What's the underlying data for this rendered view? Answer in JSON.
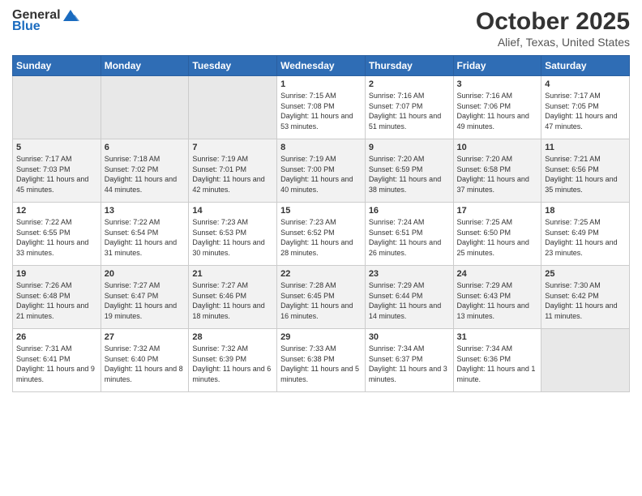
{
  "header": {
    "logo_general": "General",
    "logo_blue": "Blue",
    "month_title": "October 2025",
    "location": "Alief, Texas, United States"
  },
  "weekdays": [
    "Sunday",
    "Monday",
    "Tuesday",
    "Wednesday",
    "Thursday",
    "Friday",
    "Saturday"
  ],
  "rows": [
    [
      {
        "day": "",
        "empty": true
      },
      {
        "day": "",
        "empty": true
      },
      {
        "day": "",
        "empty": true
      },
      {
        "day": "1",
        "sunrise": "7:15 AM",
        "sunset": "7:08 PM",
        "daylight": "11 hours and 53 minutes."
      },
      {
        "day": "2",
        "sunrise": "7:16 AM",
        "sunset": "7:07 PM",
        "daylight": "11 hours and 51 minutes."
      },
      {
        "day": "3",
        "sunrise": "7:16 AM",
        "sunset": "7:06 PM",
        "daylight": "11 hours and 49 minutes."
      },
      {
        "day": "4",
        "sunrise": "7:17 AM",
        "sunset": "7:05 PM",
        "daylight": "11 hours and 47 minutes."
      }
    ],
    [
      {
        "day": "5",
        "sunrise": "7:17 AM",
        "sunset": "7:03 PM",
        "daylight": "11 hours and 45 minutes."
      },
      {
        "day": "6",
        "sunrise": "7:18 AM",
        "sunset": "7:02 PM",
        "daylight": "11 hours and 44 minutes."
      },
      {
        "day": "7",
        "sunrise": "7:19 AM",
        "sunset": "7:01 PM",
        "daylight": "11 hours and 42 minutes."
      },
      {
        "day": "8",
        "sunrise": "7:19 AM",
        "sunset": "7:00 PM",
        "daylight": "11 hours and 40 minutes."
      },
      {
        "day": "9",
        "sunrise": "7:20 AM",
        "sunset": "6:59 PM",
        "daylight": "11 hours and 38 minutes."
      },
      {
        "day": "10",
        "sunrise": "7:20 AM",
        "sunset": "6:58 PM",
        "daylight": "11 hours and 37 minutes."
      },
      {
        "day": "11",
        "sunrise": "7:21 AM",
        "sunset": "6:56 PM",
        "daylight": "11 hours and 35 minutes."
      }
    ],
    [
      {
        "day": "12",
        "sunrise": "7:22 AM",
        "sunset": "6:55 PM",
        "daylight": "11 hours and 33 minutes."
      },
      {
        "day": "13",
        "sunrise": "7:22 AM",
        "sunset": "6:54 PM",
        "daylight": "11 hours and 31 minutes."
      },
      {
        "day": "14",
        "sunrise": "7:23 AM",
        "sunset": "6:53 PM",
        "daylight": "11 hours and 30 minutes."
      },
      {
        "day": "15",
        "sunrise": "7:23 AM",
        "sunset": "6:52 PM",
        "daylight": "11 hours and 28 minutes."
      },
      {
        "day": "16",
        "sunrise": "7:24 AM",
        "sunset": "6:51 PM",
        "daylight": "11 hours and 26 minutes."
      },
      {
        "day": "17",
        "sunrise": "7:25 AM",
        "sunset": "6:50 PM",
        "daylight": "11 hours and 25 minutes."
      },
      {
        "day": "18",
        "sunrise": "7:25 AM",
        "sunset": "6:49 PM",
        "daylight": "11 hours and 23 minutes."
      }
    ],
    [
      {
        "day": "19",
        "sunrise": "7:26 AM",
        "sunset": "6:48 PM",
        "daylight": "11 hours and 21 minutes."
      },
      {
        "day": "20",
        "sunrise": "7:27 AM",
        "sunset": "6:47 PM",
        "daylight": "11 hours and 19 minutes."
      },
      {
        "day": "21",
        "sunrise": "7:27 AM",
        "sunset": "6:46 PM",
        "daylight": "11 hours and 18 minutes."
      },
      {
        "day": "22",
        "sunrise": "7:28 AM",
        "sunset": "6:45 PM",
        "daylight": "11 hours and 16 minutes."
      },
      {
        "day": "23",
        "sunrise": "7:29 AM",
        "sunset": "6:44 PM",
        "daylight": "11 hours and 14 minutes."
      },
      {
        "day": "24",
        "sunrise": "7:29 AM",
        "sunset": "6:43 PM",
        "daylight": "11 hours and 13 minutes."
      },
      {
        "day": "25",
        "sunrise": "7:30 AM",
        "sunset": "6:42 PM",
        "daylight": "11 hours and 11 minutes."
      }
    ],
    [
      {
        "day": "26",
        "sunrise": "7:31 AM",
        "sunset": "6:41 PM",
        "daylight": "11 hours and 9 minutes."
      },
      {
        "day": "27",
        "sunrise": "7:32 AM",
        "sunset": "6:40 PM",
        "daylight": "11 hours and 8 minutes."
      },
      {
        "day": "28",
        "sunrise": "7:32 AM",
        "sunset": "6:39 PM",
        "daylight": "11 hours and 6 minutes."
      },
      {
        "day": "29",
        "sunrise": "7:33 AM",
        "sunset": "6:38 PM",
        "daylight": "11 hours and 5 minutes."
      },
      {
        "day": "30",
        "sunrise": "7:34 AM",
        "sunset": "6:37 PM",
        "daylight": "11 hours and 3 minutes."
      },
      {
        "day": "31",
        "sunrise": "7:34 AM",
        "sunset": "6:36 PM",
        "daylight": "11 hours and 1 minute."
      },
      {
        "day": "",
        "empty": true
      }
    ]
  ]
}
